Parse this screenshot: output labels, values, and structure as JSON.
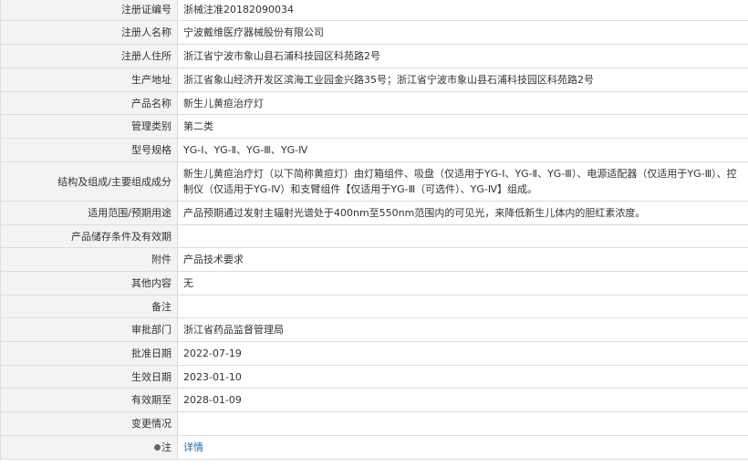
{
  "rows": [
    {
      "label": "注册证编号",
      "value": "浙械注准20182090034",
      "h": 25
    },
    {
      "label": "注册人名称",
      "value": "宁波戴维医疗器械股份有限公司",
      "h": 26
    },
    {
      "label": "注册人住所",
      "value": "浙江省宁波市象山县石浦科技园区科苑路2号",
      "h": 26
    },
    {
      "label": "生产地址",
      "value": "浙江省象山经济开发区滨海工业园金兴路35号；浙江省宁波市象山县石浦科技园区科苑路2号",
      "h": 26
    },
    {
      "label": "产品名称",
      "value": "新生儿黄疸治疗灯",
      "h": 25
    },
    {
      "label": "管理类别",
      "value": "第二类",
      "h": 26
    },
    {
      "label": "型号规格",
      "value": "YG-Ⅰ、YG-Ⅱ、YG-Ⅲ、YG-Ⅳ",
      "h": 26
    },
    {
      "label": "结构及组成/主要组成成分",
      "value": "新生儿黄疸治疗灯（以下简称黄疸灯）由灯箱组件、吸盘（仅适用于YG-Ⅰ、YG-Ⅱ、YG-Ⅲ）、电源适配器（仅适用于YG-Ⅲ）、控制仪（仅适用于YG-Ⅳ）和支臂组件【仅适用于YG-Ⅲ（可选件）、YG-Ⅳ】组成。",
      "h": 43
    },
    {
      "label": "适用范围/预期用途",
      "value": "产品预期通过发射主辐射光谱处于400nm至550nm范围内的可见光，来降低新生儿体内的胆红素浓度。",
      "h": 26
    },
    {
      "label": "产品储存条件及有效期",
      "value": "",
      "h": 25
    },
    {
      "label": "附件",
      "value": "产品技术要求",
      "h": 26
    },
    {
      "label": "其他内容",
      "value": "无",
      "h": 26
    },
    {
      "label": "备注",
      "value": "",
      "h": 25
    },
    {
      "label": "审批部门",
      "value": "浙江省药品监督管理局",
      "h": 26
    },
    {
      "label": "批准日期",
      "value": "2022-07-19",
      "h": 26
    },
    {
      "label": "生效日期",
      "value": "2023-01-10",
      "h": 25
    },
    {
      "label": "有效期至",
      "value": "2028-01-09",
      "h": 26
    },
    {
      "label": "变更情况",
      "value": "",
      "h": 26
    }
  ],
  "footer": {
    "label": "注",
    "link": "详情",
    "pin_icon": "pin-icon"
  }
}
